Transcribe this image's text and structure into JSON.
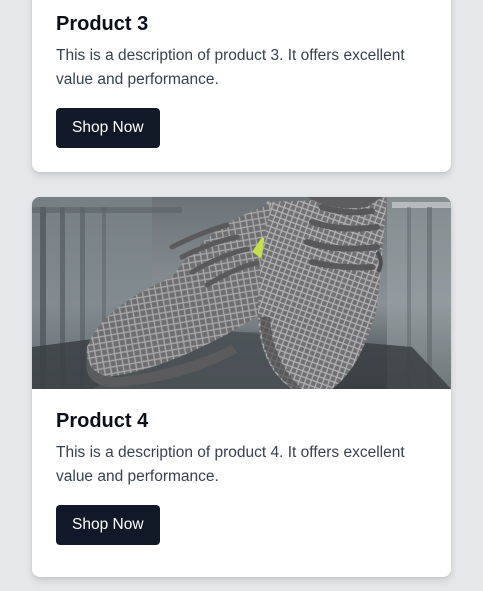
{
  "products": [
    {
      "title": "Product 3",
      "description": "This is a description of product 3. It offers excellent value and performance.",
      "button_label": "Shop Now"
    },
    {
      "title": "Product 4",
      "description": "This is a description of product 4. It offers excellent value and performance.",
      "button_label": "Shop Now",
      "image_subject": "grey-mesh-sneakers"
    }
  ],
  "colors": {
    "page_background": "#e5e7eb",
    "card_background": "#ffffff",
    "button_background": "#111827",
    "button_text": "#ffffff",
    "title_text": "#0b0f19",
    "body_text": "#374151"
  }
}
